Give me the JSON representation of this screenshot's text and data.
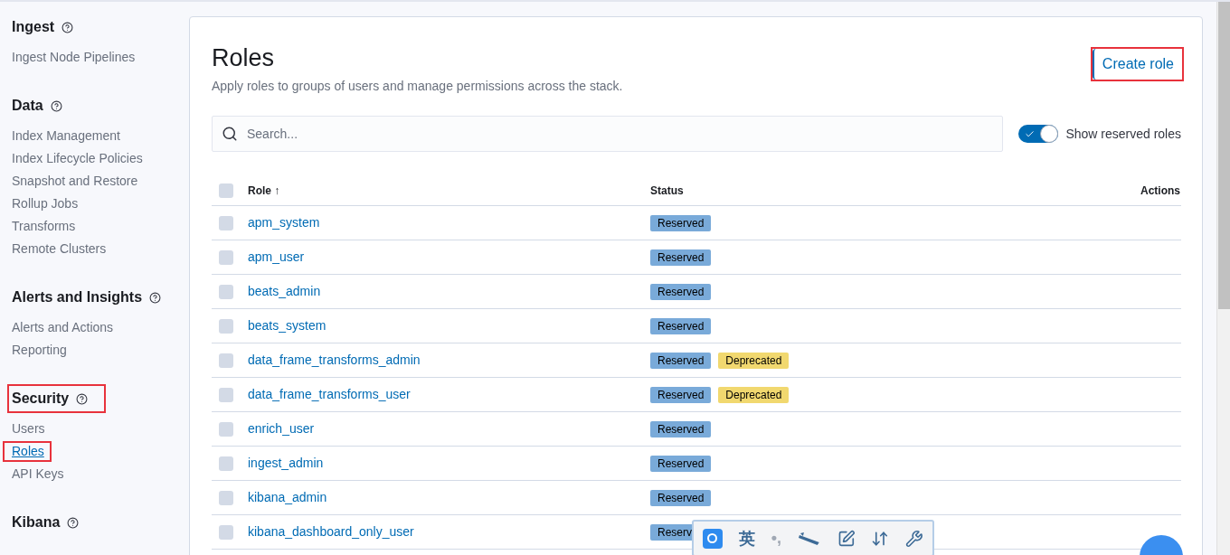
{
  "sidebar": {
    "sections": [
      {
        "title": "Ingest",
        "highlighted": false,
        "items": [
          {
            "label": "Ingest Node Pipelines",
            "selected": false,
            "highlighted": false
          }
        ]
      },
      {
        "title": "Data",
        "highlighted": false,
        "items": [
          {
            "label": "Index Management",
            "selected": false,
            "highlighted": false
          },
          {
            "label": "Index Lifecycle Policies",
            "selected": false,
            "highlighted": false
          },
          {
            "label": "Snapshot and Restore",
            "selected": false,
            "highlighted": false
          },
          {
            "label": "Rollup Jobs",
            "selected": false,
            "highlighted": false
          },
          {
            "label": "Transforms",
            "selected": false,
            "highlighted": false
          },
          {
            "label": "Remote Clusters",
            "selected": false,
            "highlighted": false
          }
        ]
      },
      {
        "title": "Alerts and Insights",
        "highlighted": false,
        "items": [
          {
            "label": "Alerts and Actions",
            "selected": false,
            "highlighted": false
          },
          {
            "label": "Reporting",
            "selected": false,
            "highlighted": false
          }
        ]
      },
      {
        "title": "Security",
        "highlighted": true,
        "items": [
          {
            "label": "Users",
            "selected": false,
            "highlighted": false
          },
          {
            "label": "Roles",
            "selected": true,
            "highlighted": true
          },
          {
            "label": "API Keys",
            "selected": false,
            "highlighted": false
          }
        ]
      },
      {
        "title": "Kibana",
        "highlighted": false
      }
    ]
  },
  "page": {
    "title": "Roles",
    "description": "Apply roles to groups of users and manage permissions across the stack.",
    "create_button": {
      "label": "Create role",
      "highlighted": true
    }
  },
  "search": {
    "placeholder": "Search..."
  },
  "show_reserved": {
    "label": "Show reserved roles",
    "on": true
  },
  "table": {
    "all_checked": false,
    "columns": [
      "Role ↑",
      "Status",
      "Actions"
    ],
    "rows": [
      {
        "role": "apm_system",
        "checked": false,
        "badges": [
          {
            "kind": "reserved",
            "label": "Reserved"
          }
        ]
      },
      {
        "role": "apm_user",
        "checked": false,
        "badges": [
          {
            "kind": "reserved",
            "label": "Reserved"
          }
        ]
      },
      {
        "role": "beats_admin",
        "checked": false,
        "badges": [
          {
            "kind": "reserved",
            "label": "Reserved"
          }
        ]
      },
      {
        "role": "beats_system",
        "checked": false,
        "badges": [
          {
            "kind": "reserved",
            "label": "Reserved"
          }
        ]
      },
      {
        "role": "data_frame_transforms_admin",
        "checked": false,
        "badges": [
          {
            "kind": "reserved",
            "label": "Reserved"
          },
          {
            "kind": "deprecated",
            "label": "Deprecated"
          }
        ]
      },
      {
        "role": "data_frame_transforms_user",
        "checked": false,
        "badges": [
          {
            "kind": "reserved",
            "label": "Reserved"
          },
          {
            "kind": "deprecated",
            "label": "Deprecated"
          }
        ]
      },
      {
        "role": "enrich_user",
        "checked": false,
        "badges": [
          {
            "kind": "reserved",
            "label": "Reserved"
          }
        ]
      },
      {
        "role": "ingest_admin",
        "checked": false,
        "badges": [
          {
            "kind": "reserved",
            "label": "Reserved"
          }
        ]
      },
      {
        "role": "kibana_admin",
        "checked": false,
        "badges": [
          {
            "kind": "reserved",
            "label": "Reserved"
          }
        ]
      },
      {
        "role": "kibana_dashboard_only_user",
        "checked": false,
        "badges": [
          {
            "kind": "reserved",
            "label": "Reserv"
          }
        ]
      }
    ]
  },
  "ime_toolbar": {
    "language": "英",
    "punctuation": "•,"
  }
}
